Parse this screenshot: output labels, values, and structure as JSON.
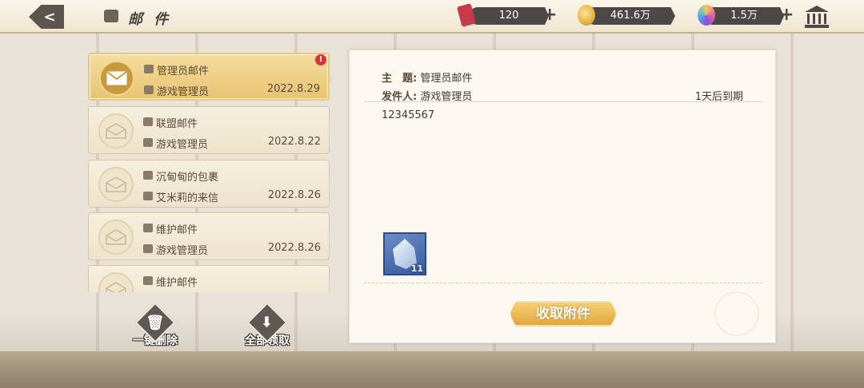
{
  "header": {
    "back_label": "<",
    "title": "邮 件"
  },
  "resources": {
    "tickets": "120",
    "gold": "461.6万",
    "gems": "1.5万"
  },
  "colors": {
    "ticket": "#c83a4a",
    "gold": "#e2b23a",
    "gem": "#a450d8",
    "claim": "#e1a840",
    "alert": "#d8333a"
  },
  "mails": [
    {
      "title": "管理员邮件",
      "sender": "游戏管理员",
      "date": "2022.8.29",
      "selected": true,
      "unread": true
    },
    {
      "title": "联盟邮件",
      "sender": "游戏管理员",
      "date": "2022.8.22"
    },
    {
      "title": "沉甸甸的包裹",
      "sender": "艾米莉的来信",
      "date": "2022.8.26"
    },
    {
      "title": "维护邮件",
      "sender": "游戏管理员",
      "date": "2022.8.26"
    },
    {
      "title": "维护邮件",
      "sender": "",
      "date": ""
    }
  ],
  "alert_mark": "!",
  "actions": {
    "delete_all": "一键删除",
    "claim_all": "全部领取"
  },
  "detail": {
    "subject_key": "主　题:",
    "subject": "管理员邮件",
    "sender_key": "发件人:",
    "sender": "游戏管理员",
    "expiry": "1天后到期",
    "body": "12345567",
    "attachment_count": "11",
    "claim_label": "收取附件"
  }
}
